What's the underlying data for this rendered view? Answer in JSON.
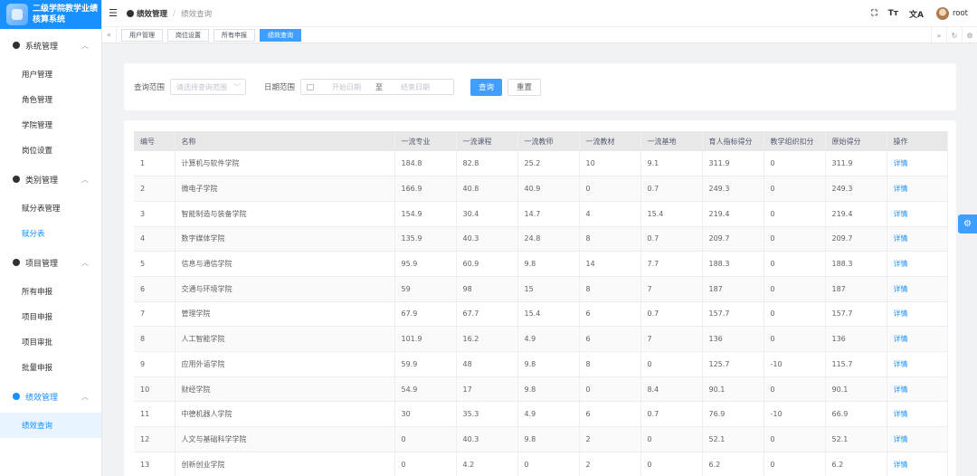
{
  "brand": {
    "title": "二级学院教学业绩核算系统"
  },
  "sidebar": {
    "groups": [
      {
        "label": "系统管理",
        "items": [
          "用户管理",
          "角色管理",
          "学院管理",
          "岗位设置"
        ]
      },
      {
        "label": "类别管理",
        "items": [
          "赋分表管理",
          "赋分表"
        ]
      },
      {
        "label": "项目管理",
        "items": [
          "所有申报",
          "项目申报",
          "项目审批",
          "批量申报"
        ]
      },
      {
        "label": "绩效管理",
        "items": [
          "绩效查询"
        ]
      }
    ]
  },
  "header": {
    "breadcrumb_home": "绩效管理",
    "breadcrumb_current": "绩效查询",
    "username": "root",
    "icons": [
      "fullscreen-icon",
      "font-size-icon",
      "translate-icon"
    ]
  },
  "tags": [
    "用户管理",
    "岗位设置",
    "所有申报",
    "绩效查询"
  ],
  "search": {
    "scope_label": "查询范围",
    "scope_placeholder": "请选择查询范围",
    "date_label": "日期范围",
    "start_placeholder": "开始日期",
    "range_sep": "至",
    "end_placeholder": "结束日期",
    "query_button": "查询",
    "reset_button": "重置"
  },
  "table": {
    "columns": [
      "编号",
      "名称",
      "一流专业",
      "一流课程",
      "一流教师",
      "一流教材",
      "一流基地",
      "育人指标得分",
      "教学组织扣分",
      "原始得分",
      "操作"
    ],
    "rows": [
      [
        "1",
        "计算机与软件学院",
        "184.8",
        "82.8",
        "25.2",
        "10",
        "9.1",
        "311.9",
        "0",
        "311.9",
        "详情"
      ],
      [
        "2",
        "微电子学院",
        "166.9",
        "40.8",
        "40.9",
        "0",
        "0.7",
        "249.3",
        "0",
        "249.3",
        "详情"
      ],
      [
        "3",
        "智能制造与装备学院",
        "154.9",
        "30.4",
        "14.7",
        "4",
        "15.4",
        "219.4",
        "0",
        "219.4",
        "详情"
      ],
      [
        "4",
        "数字媒体学院",
        "135.9",
        "40.3",
        "24.8",
        "8",
        "0.7",
        "209.7",
        "0",
        "209.7",
        "详情"
      ],
      [
        "5",
        "信息与通信学院",
        "95.9",
        "60.9",
        "9.8",
        "14",
        "7.7",
        "188.3",
        "0",
        "188.3",
        "详情"
      ],
      [
        "6",
        "交通与环境学院",
        "59",
        "98",
        "15",
        "8",
        "7",
        "187",
        "0",
        "187",
        "详情"
      ],
      [
        "7",
        "管理学院",
        "67.9",
        "67.7",
        "15.4",
        "6",
        "0.7",
        "157.7",
        "0",
        "157.7",
        "详情"
      ],
      [
        "8",
        "人工智能学院",
        "101.9",
        "16.2",
        "4.9",
        "6",
        "7",
        "136",
        "0",
        "136",
        "详情"
      ],
      [
        "9",
        "应用外语学院",
        "59.9",
        "48",
        "9.8",
        "8",
        "0",
        "125.7",
        "-10",
        "115.7",
        "详情"
      ],
      [
        "10",
        "财经学院",
        "54.9",
        "17",
        "9.8",
        "0",
        "8.4",
        "90.1",
        "0",
        "90.1",
        "详情"
      ],
      [
        "11",
        "中德机器人学院",
        "30",
        "35.3",
        "4.9",
        "6",
        "0.7",
        "76.9",
        "-10",
        "66.9",
        "详情"
      ],
      [
        "12",
        "人文与基础科学学院",
        "0",
        "40.3",
        "9.8",
        "2",
        "0",
        "52.1",
        "0",
        "52.1",
        "详情"
      ],
      [
        "13",
        "创新创业学院",
        "0",
        "4.2",
        "0",
        "2",
        "0",
        "6.2",
        "0",
        "6.2",
        "详情"
      ]
    ]
  }
}
